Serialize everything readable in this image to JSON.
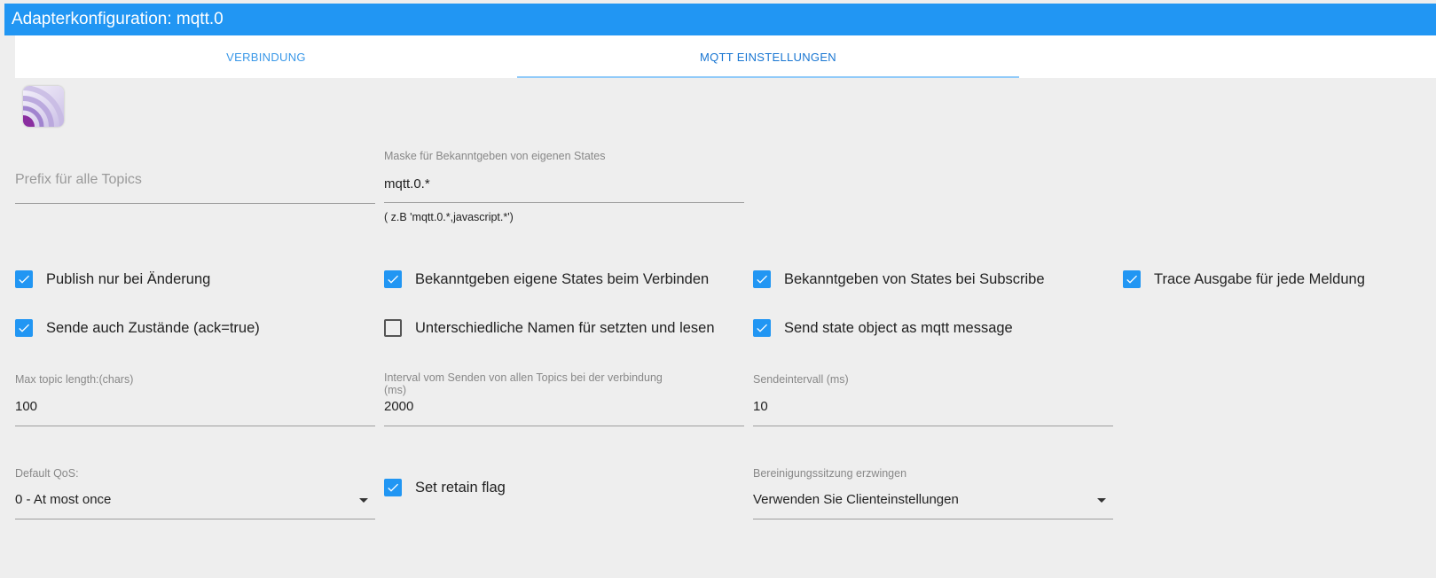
{
  "title": "Adapterkonfiguration: mqtt.0",
  "tabs": [
    {
      "label": "VERBINDUNG"
    },
    {
      "label": "MQTT EINSTELLUNGEN"
    }
  ],
  "active_tab": "MQTT EINSTELLUNGEN",
  "logo": {
    "icon": "mqtt-logo-icon"
  },
  "prefix": {
    "placeholder": "Prefix für alle Topics",
    "value": ""
  },
  "mask": {
    "label": "Maske für Bekanntgeben von eigenen States",
    "value": "mqtt.0.*",
    "help": "( z.B 'mqtt.0.*,javascript.*')"
  },
  "checkboxes": {
    "publish_on_change": {
      "label": "Publish nur bei Änderung",
      "checked": true
    },
    "announce_on_connect": {
      "label": "Bekanntgeben eigene States beim Verbinden",
      "checked": true
    },
    "announce_on_subscribe": {
      "label": "Bekanntgeben von States bei Subscribe",
      "checked": true
    },
    "trace_output": {
      "label": "Trace Ausgabe für jede Meldung",
      "checked": true
    },
    "send_ack": {
      "label": "Sende auch Zustände (ack=true)",
      "checked": true
    },
    "different_names": {
      "label": "Unterschiedliche Namen für setzten und lesen",
      "checked": false
    },
    "send_state_object": {
      "label": "Send state object as mqtt message",
      "checked": true
    },
    "retain_flag": {
      "label": "Set retain flag",
      "checked": true
    }
  },
  "max_topic_length": {
    "label": "Max topic length:(chars)",
    "value": "100"
  },
  "send_interval_all": {
    "label_line1": "Interval vom Senden von allen Topics bei der verbindung",
    "label_line2": "(ms)",
    "value": "2000"
  },
  "send_interval": {
    "label": "Sendeintervall (ms)",
    "value": "10"
  },
  "default_qos": {
    "label": "Default QoS:",
    "value": "0 - At most once"
  },
  "clean_session": {
    "label": "Bereinigungssitzung erzwingen",
    "value": "Verwenden Sie Clienteinstellungen"
  },
  "colors": {
    "accent": "#2196f3",
    "background": "#eeeeee",
    "tab_active": "#1976d2"
  }
}
